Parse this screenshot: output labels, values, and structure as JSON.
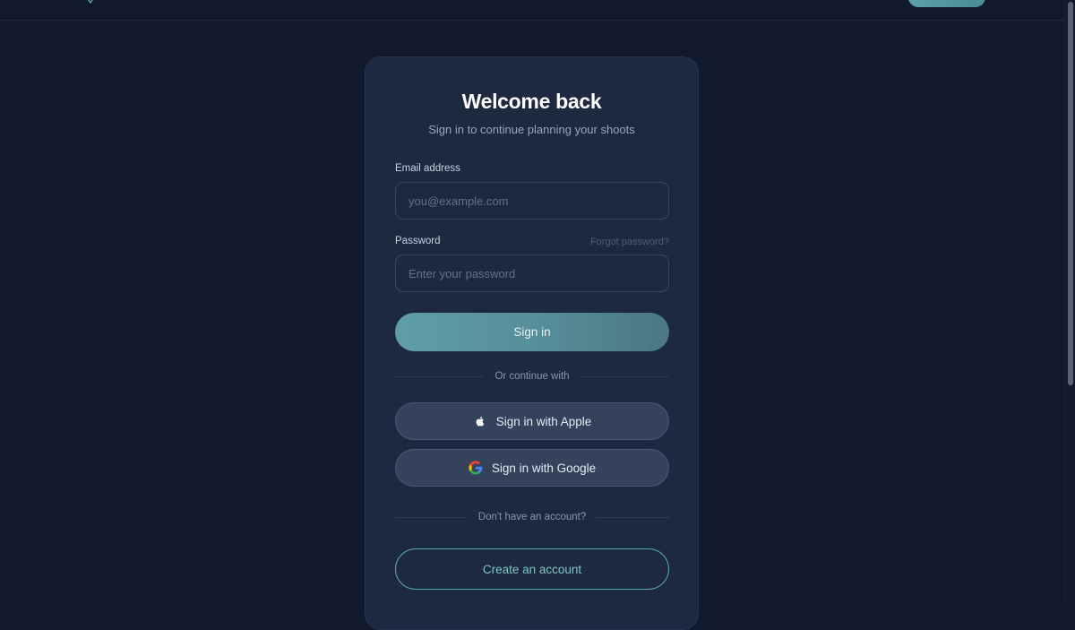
{
  "card": {
    "title": "Welcome back",
    "subtitle": "Sign in to continue planning your shoots"
  },
  "form": {
    "email_label": "Email address",
    "email_placeholder": "you@example.com",
    "email_value": "",
    "password_label": "Password",
    "password_placeholder": "Enter your password",
    "password_value": "",
    "forgot_link": "Forgot password?",
    "submit_label": "Sign in"
  },
  "social": {
    "divider_text": "Or continue with",
    "apple_label": "Sign in with Apple",
    "apple_icon": "apple-icon",
    "google_label": "Sign in with Google",
    "google_icon": "google-icon"
  },
  "signup": {
    "divider_text": "Don't have an account?",
    "create_label": "Create an account"
  },
  "colors": {
    "background": "#111a2c",
    "card": "#1d2940",
    "accent": "#5f9ea7",
    "social_button": "#34425c"
  }
}
